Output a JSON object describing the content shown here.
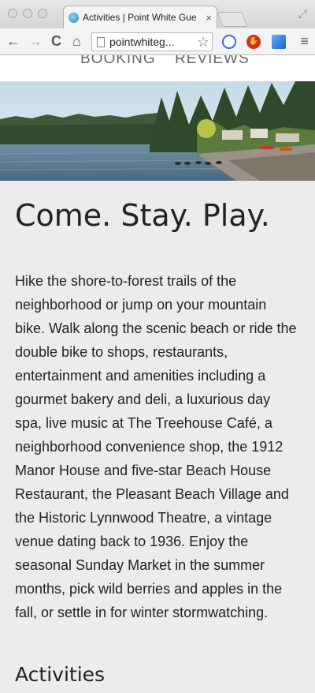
{
  "browser": {
    "tab_title": "Activities | Point White Gue",
    "tab_close": "×",
    "url": "pointwhiteg...",
    "star": "☆",
    "menu": "≡",
    "back": "←",
    "forward": "→",
    "reload": "C",
    "home": "⌂"
  },
  "site_nav": {
    "items": [
      "BOOKING",
      "REVIEWS"
    ]
  },
  "content": {
    "title": "Come. Stay. Play.",
    "body": "Hike the shore-to-forest trails of the neighborhood or jump on your mountain bike. Walk along the scenic beach or ride the double bike to shops, restaurants, entertainment and amenities including a gourmet bakery and deli, a luxurious day spa, live music at The Treehouse Café, a neighborhood convenience shop, the 1912 Manor House and five-star Beach House Restaurant, the Pleasant Beach Village and the Historic Lynnwood Theatre, a vintage venue dating back to 1936. Enjoy the seasonal Sunday Market in the summer months, pick wild berries and apples in the fall, or settle in for winter stormwatching.",
    "section_heading": "Activities"
  },
  "colors": {
    "page_background": "#ececec",
    "text": "#222222",
    "nav_text": "#666666"
  }
}
